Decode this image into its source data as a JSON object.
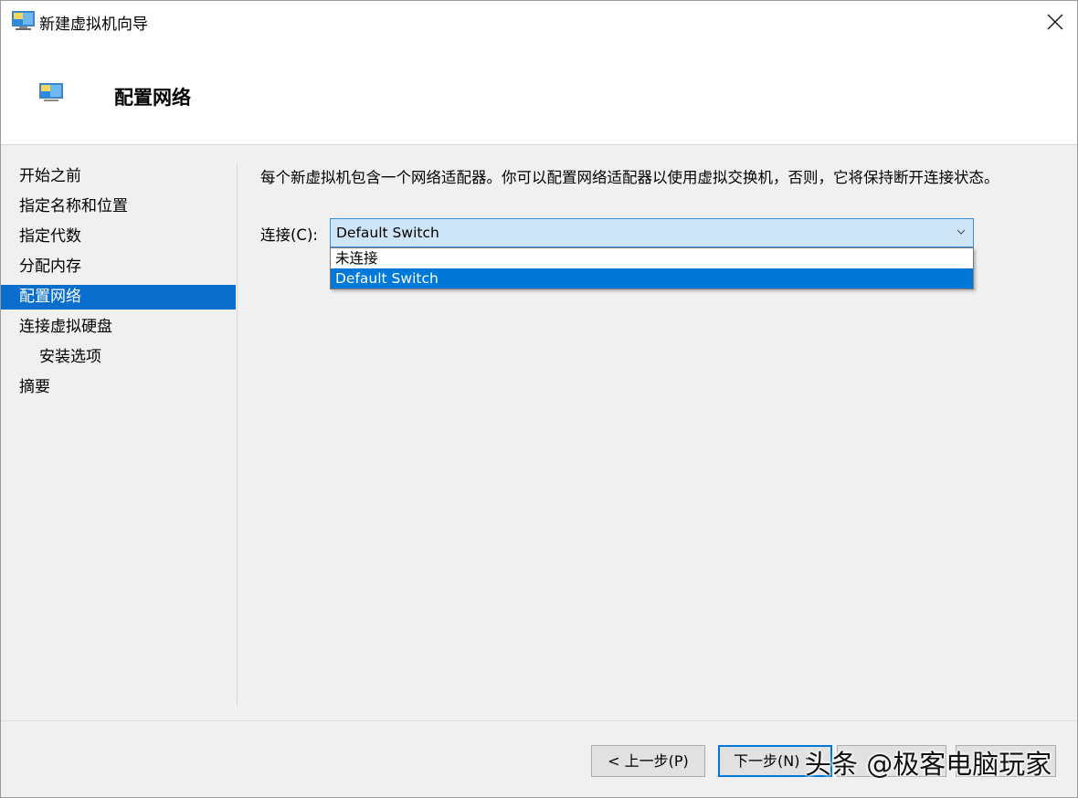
{
  "window": {
    "title": "新建虚拟机向导",
    "icon": "hyperv-monitor-icon"
  },
  "header": {
    "title": "配置网络",
    "icon": "hyperv-monitor-icon"
  },
  "nav": {
    "items": [
      {
        "label": "开始之前",
        "active": false,
        "indent": false
      },
      {
        "label": "指定名称和位置",
        "active": false,
        "indent": false
      },
      {
        "label": "指定代数",
        "active": false,
        "indent": false
      },
      {
        "label": "分配内存",
        "active": false,
        "indent": false
      },
      {
        "label": "配置网络",
        "active": true,
        "indent": false
      },
      {
        "label": "连接虚拟硬盘",
        "active": false,
        "indent": false
      },
      {
        "label": "安装选项",
        "active": false,
        "indent": true
      },
      {
        "label": "摘要",
        "active": false,
        "indent": false
      }
    ]
  },
  "content": {
    "description": "每个新虚拟机包含一个网络适配器。你可以配置网络适配器以使用虚拟交换机，否则，它将保持断开连接状态。",
    "connection_label": "连接(C):",
    "connection_value": "Default Switch",
    "options": [
      {
        "label": "未连接",
        "selected": false
      },
      {
        "label": "Default Switch",
        "selected": true
      }
    ]
  },
  "footer": {
    "prev_label": "< 上一步(P)",
    "next_label": "下一步(N) >",
    "btn3_label": "",
    "btn4_label": ""
  },
  "watermark": "头条 @极客电脑玩家",
  "colors": {
    "accent": "#0078d7",
    "nav_active": "#0a6fcc",
    "combo_bg": "#cde5f7",
    "window_bg": "#f0f0f0"
  }
}
